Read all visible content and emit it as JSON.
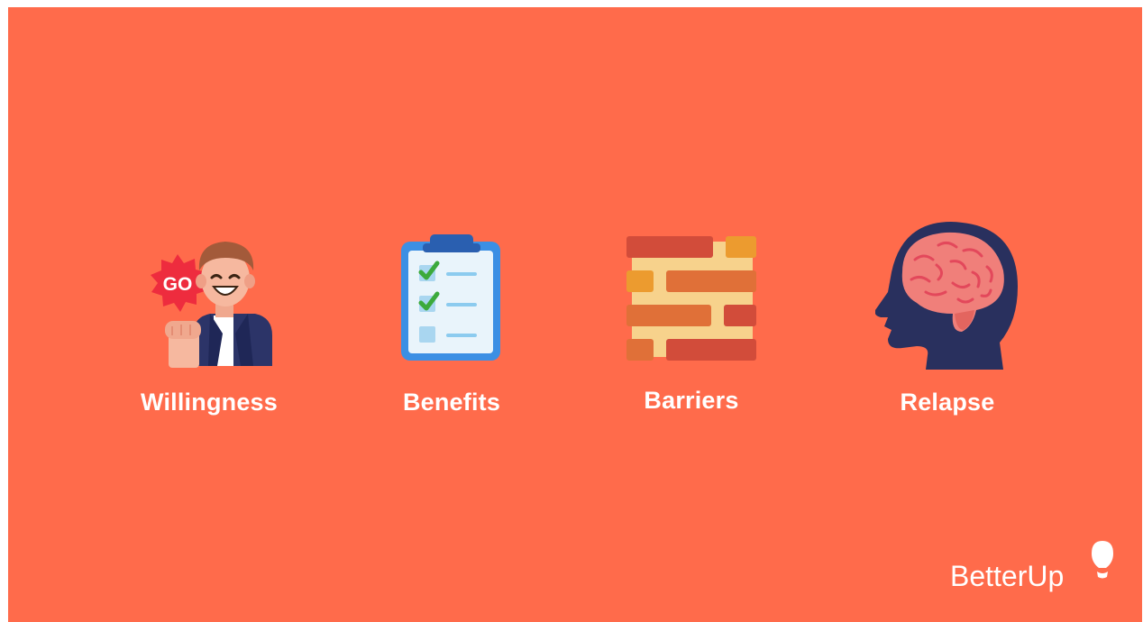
{
  "items": [
    {
      "label": "Willingness",
      "icon": "go-person-icon",
      "badge": "GO"
    },
    {
      "label": "Benefits",
      "icon": "checklist-clipboard-icon"
    },
    {
      "label": "Barriers",
      "icon": "brick-wall-icon"
    },
    {
      "label": "Relapse",
      "icon": "head-brain-icon"
    }
  ],
  "brand": {
    "name": "BetterUp",
    "icon": "lightbulb-logo-icon"
  },
  "colors": {
    "background": "#ff6b4b",
    "text": "#ffffff"
  }
}
